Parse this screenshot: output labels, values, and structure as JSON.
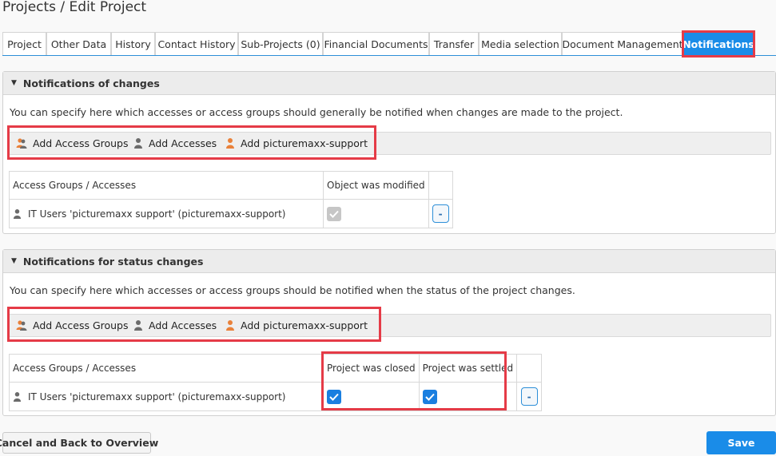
{
  "page": {
    "title": "Projects / Edit Project"
  },
  "tabs": [
    {
      "label": "Project"
    },
    {
      "label": "Other Data"
    },
    {
      "label": "History"
    },
    {
      "label": "Contact History"
    },
    {
      "label": "Sub-Projects (0)"
    },
    {
      "label": "Financial Documents"
    },
    {
      "label": "Transfer"
    },
    {
      "label": "Media selection"
    },
    {
      "label": "Document Management"
    },
    {
      "label": "Notifications",
      "active": true
    }
  ],
  "section_changes": {
    "title": "Notifications of changes",
    "description": "You can specify here which accesses or access groups should generally be notified when changes are made to the project.",
    "toolbar": {
      "add_access_groups": "Add Access Groups",
      "add_accesses": "Add Accesses",
      "add_support": "Add picturemaxx-support"
    },
    "table": {
      "columns": [
        "Access Groups / Accesses",
        "Object was modified"
      ],
      "rows": [
        {
          "name": "IT Users 'picturemaxx support' (picturemaxx-support)",
          "object_modified": true,
          "remove_label": "-"
        }
      ]
    }
  },
  "section_status": {
    "title": "Notifications for status changes",
    "description": "You can specify here which accesses or access groups should be notified when the status of the project changes.",
    "toolbar": {
      "add_access_groups": "Add Access Groups",
      "add_accesses": "Add Accesses",
      "add_support": "Add picturemaxx-support"
    },
    "table": {
      "columns": [
        "Access Groups / Accesses",
        "Project was closed",
        "Project was settled"
      ],
      "rows": [
        {
          "name": "IT Users 'picturemaxx support' (picturemaxx-support)",
          "project_closed": true,
          "project_settled": true,
          "remove_label": "-"
        }
      ]
    }
  },
  "footer": {
    "cancel_label": "Cancel and Back to Overview",
    "save_label": "Save"
  },
  "colors": {
    "accent": "#1a8ce8",
    "highlight": "#e53b47",
    "user_icon": "#6b6b6b",
    "group_icon": "#e9813a"
  },
  "icons": {
    "group": "user-group-icon",
    "user": "user-icon",
    "support": "support-user-icon",
    "section_toggle": "caret-down-icon",
    "check": "check-icon"
  }
}
